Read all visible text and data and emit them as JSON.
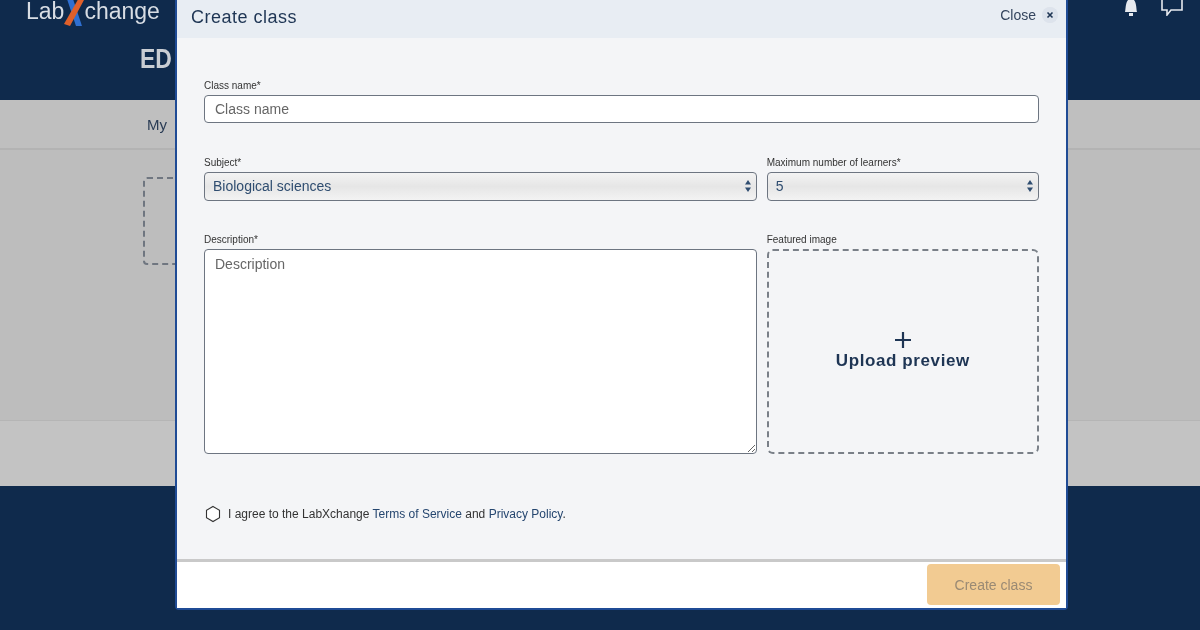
{
  "background_page": {
    "logo": {
      "left": "Lab",
      "right": "change"
    },
    "heading": "ED",
    "tab": "My"
  },
  "dialog": {
    "title": "Create class",
    "close": "Close",
    "class_name": {
      "label": "Class name*",
      "placeholder": "Class name"
    },
    "subject": {
      "label": "Subject*",
      "value": "Biological sciences"
    },
    "max_learners": {
      "label": "Maximum number of learners*",
      "value": "5"
    },
    "description": {
      "label": "Description*",
      "placeholder": "Description"
    },
    "featured_image": {
      "label": "Featured image",
      "action": "Upload preview"
    },
    "agreement": {
      "checked": false,
      "text_before": "I agree to the LabXchange ",
      "terms_link": "Terms of Service",
      "text_middle": " and ",
      "privacy_link": "Privacy Policy",
      "text_after": "."
    },
    "submit": {
      "label": "Create class",
      "disabled": true
    }
  }
}
